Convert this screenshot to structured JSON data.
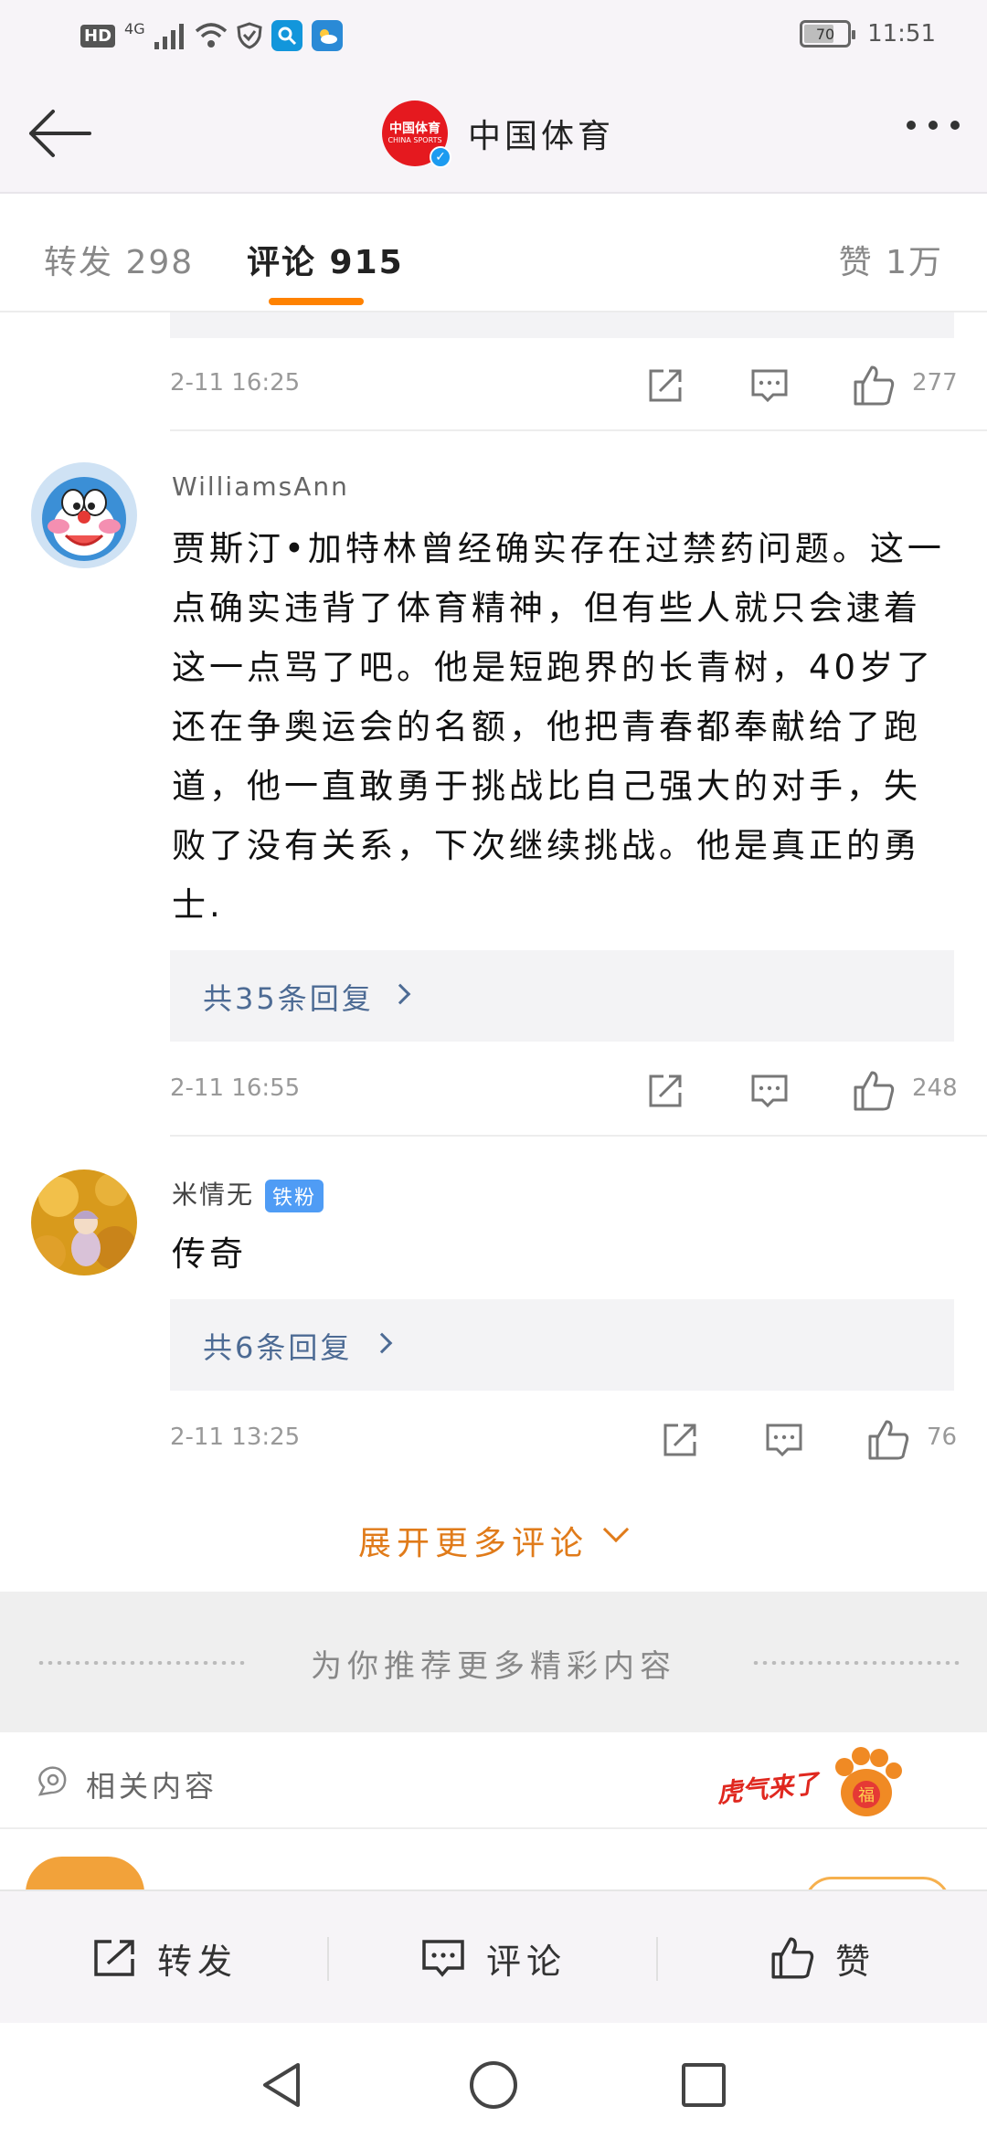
{
  "status_bar": {
    "hd": "HD",
    "network": "4G",
    "battery": "70",
    "time": "11:51",
    "battery_level": 0.7,
    "icons": [
      "signal-icon",
      "wifi-icon",
      "shield-icon",
      "search-app-icon",
      "weather-app-icon"
    ]
  },
  "nav": {
    "logo_text": "中国体育",
    "logo_sub": "CHINA SPORTS",
    "title": "中国体育"
  },
  "tabs": {
    "repost": "转发  298",
    "comment": "评论  915",
    "like": "赞  1万"
  },
  "prev_comment": {
    "time": "2-11  16:25",
    "likes": "277"
  },
  "comments": [
    {
      "user": "WilliamsAnn",
      "text": "贾斯汀•加特林曾经确实存在过禁药问题。这一点确实违背了体育精神，但有些人就只会逮着这一点骂了吧。他是短跑界的长青树，40岁了还在争奥运会的名额，他把青春都奉献给了跑道，他一直敢勇于挑战比自己强大的对手，失败了没有关系，下次继续挑战。他是真正的勇士.",
      "replies": "共35条回复",
      "time": "2-11  16:55",
      "likes": "248"
    },
    {
      "user": "米情无",
      "badge": "铁粉",
      "text": "传奇",
      "replies": "共6条回复",
      "time": "2-11  13:25",
      "likes": "76"
    }
  ],
  "expand": {
    "label": "展开更多评论"
  },
  "recommend": {
    "label": "为你推荐更多精彩内容"
  },
  "related": {
    "label": "相关内容",
    "promo_text": "虎气来了",
    "promo_badge": "福"
  },
  "bottom_bar": {
    "repost": "转发",
    "comment": "评论",
    "like": "赞"
  },
  "colors": {
    "accent": "#ff8200",
    "link": "#4d6b94",
    "expand": "#e07b1a",
    "badge": "#4f9cf5"
  }
}
